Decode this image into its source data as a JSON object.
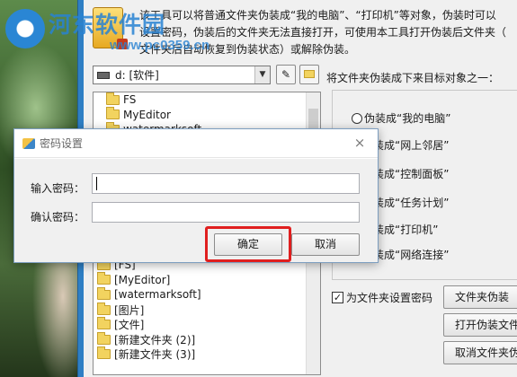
{
  "watermark": {
    "site_name": "河东软件园",
    "url": "www.pc0359.cn"
  },
  "app": {
    "description": "该工具可以将普通文件夹伪装成“我的电脑”、“打印机”等对象，伪装时可以\n设置密码，伪装后的文件夹无法直接打开，可使用本工具打开伪装后文件夹（\n文件夹后自动恢复到伪装状态）或解除伪装。",
    "drive_select": "d: [软件]",
    "target_label": "将文件夹伪装成下来目标对象之一：",
    "folders_top": [
      "FS",
      "MyEditor",
      "watermarksoft"
    ],
    "folders_bottom": [
      "[FS]",
      "[MyEditor]",
      "[watermarksoft]",
      "[图片]",
      "[文件]",
      "[新建文件夹 (2)]",
      "[新建文件夹 (3)]"
    ],
    "radio_options": [
      "伪装成“我的电脑”",
      "伪装成“网上邻居”",
      "伪装成“控制面板”",
      "伪装成“任务计划”",
      "伪装成“打印机”",
      "伪装成“网络连接”"
    ],
    "set_password_label": "为文件夹设置密码",
    "set_password_checked": true,
    "buttons": {
      "disguise": "文件夹伪装",
      "open_disguised": "打开伪装文件",
      "cancel_disguise": "取消文件夹伪"
    }
  },
  "dialog": {
    "title": "密码设置",
    "close_glyph": "×",
    "password_label": "输入密码：",
    "confirm_label": "确认密码：",
    "password_value": "",
    "confirm_value": "",
    "ok_label": "确定",
    "cancel_label": "取消"
  }
}
